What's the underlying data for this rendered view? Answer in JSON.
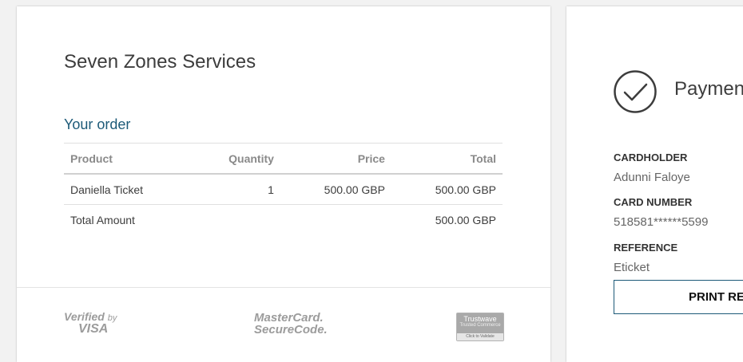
{
  "order": {
    "merchant_name": "Seven Zones Services",
    "section_title": "Your order",
    "columns": {
      "product": "Product",
      "quantity": "Quantity",
      "price": "Price",
      "total": "Total"
    },
    "items": [
      {
        "product": "Daniella Ticket",
        "quantity": "1",
        "price": "500.00 GBP",
        "total": "500.00 GBP"
      }
    ],
    "total_label": "Total Amount",
    "total_value": "500.00 GBP"
  },
  "footer": {
    "visa_line1": "Verified",
    "visa_by": "by",
    "visa_line2": "VISA",
    "mc_line1": "MasterCard.",
    "mc_line2": "SecureCode.",
    "trustwave_line1": "Trustwave",
    "trustwave_line2": "Trusted Commerce",
    "trustwave_line3": "Click to Validate"
  },
  "payment": {
    "title": "Payment",
    "cardholder_label": "CARDHOLDER",
    "cardholder_value": "Adunni Faloye",
    "card_number_label": "CARD NUMBER",
    "card_number_value": "518581******5599",
    "reference_label": "REFERENCE",
    "reference_value": "Eticket",
    "print_button": "PRINT RECEIPT"
  },
  "colors": {
    "accent": "#1d5a78",
    "text": "#3d3d3d",
    "muted": "#8a8a8a"
  }
}
